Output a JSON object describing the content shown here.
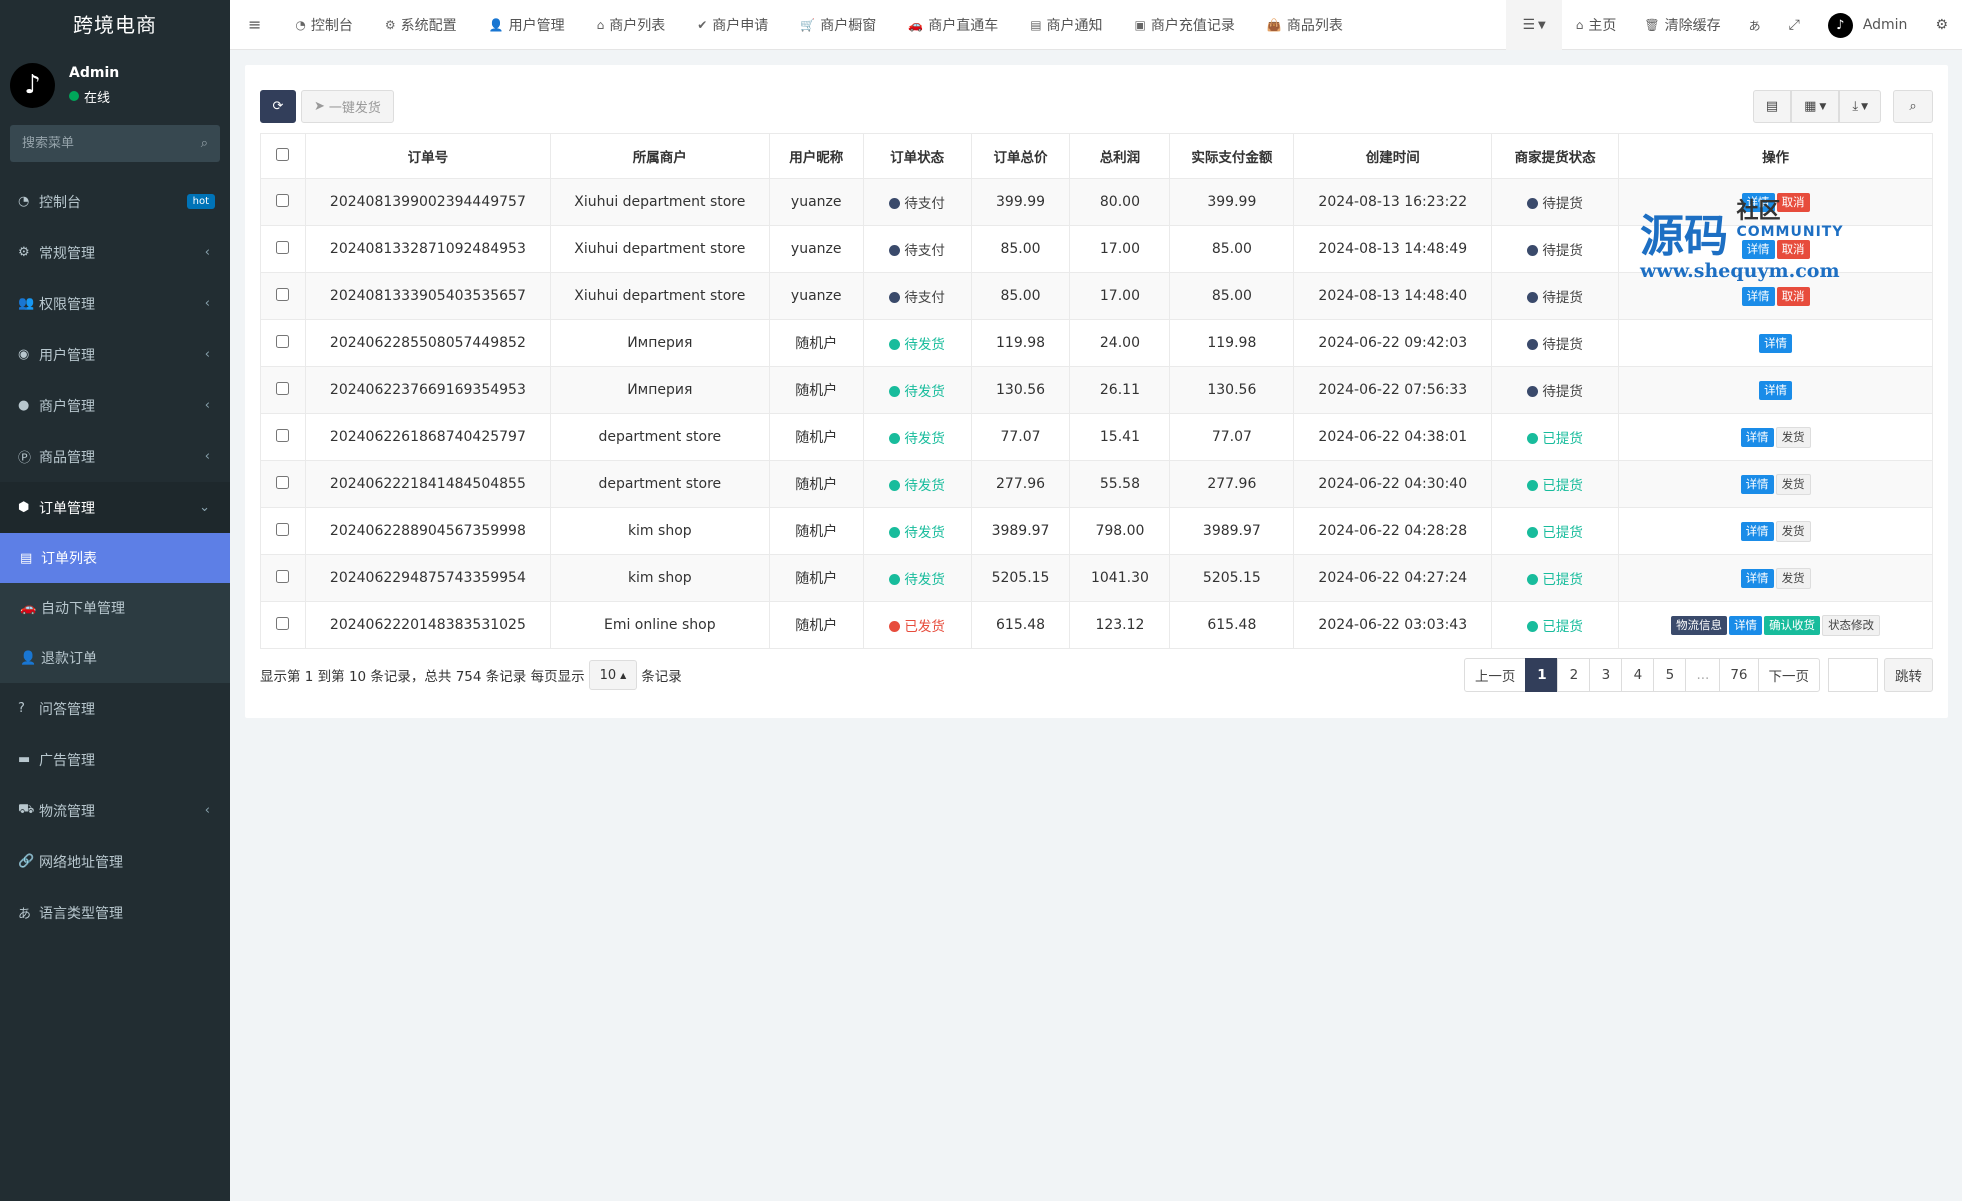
{
  "app": {
    "brand": "跨境电商"
  },
  "user": {
    "name": "Admin",
    "status": "在线"
  },
  "search": {
    "placeholder": "搜索菜单"
  },
  "sidebar": {
    "items": [
      {
        "label": "控制台",
        "icon": "dashboard-icon",
        "badge": "hot"
      },
      {
        "label": "常规管理",
        "icon": "cogs-icon"
      },
      {
        "label": "权限管理",
        "icon": "group-icon"
      },
      {
        "label": "用户管理",
        "icon": "user-circle-icon"
      },
      {
        "label": "商户管理",
        "icon": "apple-icon"
      },
      {
        "label": "商品管理",
        "icon": "product-icon"
      },
      {
        "label": "订单管理",
        "icon": "cube-icon"
      }
    ],
    "sub_items": [
      {
        "label": "订单列表",
        "icon": "list-icon"
      },
      {
        "label": "自动下单管理",
        "icon": "car-icon"
      },
      {
        "label": "退款订单",
        "icon": "user-icon"
      }
    ],
    "items_after": [
      {
        "label": "问答管理",
        "icon": "question-icon"
      },
      {
        "label": "广告管理",
        "icon": "ad-icon"
      },
      {
        "label": "物流管理",
        "icon": "truck-icon"
      },
      {
        "label": "网络地址管理",
        "icon": "link-icon"
      },
      {
        "label": "语言类型管理",
        "icon": "language-icon"
      }
    ]
  },
  "topnav": {
    "items": [
      {
        "label": "控制台",
        "icon": "dashboard-icon"
      },
      {
        "label": "系统配置",
        "icon": "gear-icon"
      },
      {
        "label": "用户管理",
        "icon": "user-icon"
      },
      {
        "label": "商户列表",
        "icon": "home-icon"
      },
      {
        "label": "商户申请",
        "icon": "check-circle-icon"
      },
      {
        "label": "商户橱窗",
        "icon": "cart-icon"
      },
      {
        "label": "商户直通车",
        "icon": "car-icon"
      },
      {
        "label": "商户通知",
        "icon": "list-icon"
      },
      {
        "label": "商户充值记录",
        "icon": "money-icon"
      },
      {
        "label": "商品列表",
        "icon": "shopping-bag-icon"
      }
    ],
    "home": "主页",
    "clear_cache": "清除缓存",
    "admin": "Admin"
  },
  "toolbar": {
    "ship_all": "一键发货"
  },
  "table": {
    "columns": [
      "订单号",
      "所属商户",
      "用户昵称",
      "订单状态",
      "订单总价",
      "总利润",
      "实际支付金额",
      "创建时间",
      "商家提货状态",
      "操作"
    ],
    "rows": [
      {
        "order_no": "2024081399002394449757",
        "merchant": "Xiuhui department store",
        "nick": "yuanze",
        "status": "待支付",
        "total": "399.99",
        "profit": "80.00",
        "paid": "399.99",
        "created": "2024-08-13 16:23:22",
        "pickup": "待提货"
      },
      {
        "order_no": "2024081332871092484953",
        "merchant": "Xiuhui department store",
        "nick": "yuanze",
        "status": "待支付",
        "total": "85.00",
        "profit": "17.00",
        "paid": "85.00",
        "created": "2024-08-13 14:48:49",
        "pickup": "待提货"
      },
      {
        "order_no": "2024081333905403535657",
        "merchant": "Xiuhui department store",
        "nick": "yuanze",
        "status": "待支付",
        "total": "85.00",
        "profit": "17.00",
        "paid": "85.00",
        "created": "2024-08-13 14:48:40",
        "pickup": "待提货"
      },
      {
        "order_no": "2024062285508057449852",
        "merchant": "Империя",
        "nick": "随机户",
        "status": "待发货",
        "total": "119.98",
        "profit": "24.00",
        "paid": "119.98",
        "created": "2024-06-22 09:42:03",
        "pickup": "待提货"
      },
      {
        "order_no": "2024062237669169354953",
        "merchant": "Империя",
        "nick": "随机户",
        "status": "待发货",
        "total": "130.56",
        "profit": "26.11",
        "paid": "130.56",
        "created": "2024-06-22 07:56:33",
        "pickup": "待提货"
      },
      {
        "order_no": "2024062261868740425797",
        "merchant": "department store",
        "nick": "随机户",
        "status": "待发货",
        "total": "77.07",
        "profit": "15.41",
        "paid": "77.07",
        "created": "2024-06-22 04:38:01",
        "pickup": "已提货"
      },
      {
        "order_no": "2024062221841484504855",
        "merchant": "department store",
        "nick": "随机户",
        "status": "待发货",
        "total": "277.96",
        "profit": "55.58",
        "paid": "277.96",
        "created": "2024-06-22 04:30:40",
        "pickup": "已提货"
      },
      {
        "order_no": "2024062288904567359998",
        "merchant": "kim shop",
        "nick": "随机户",
        "status": "待发货",
        "total": "3989.97",
        "profit": "798.00",
        "paid": "3989.97",
        "created": "2024-06-22 04:28:28",
        "pickup": "已提货"
      },
      {
        "order_no": "2024062294875743359954",
        "merchant": "kim shop",
        "nick": "随机户",
        "status": "待发货",
        "total": "5205.15",
        "profit": "1041.30",
        "paid": "5205.15",
        "created": "2024-06-22 04:27:24",
        "pickup": "已提货"
      },
      {
        "order_no": "2024062220148383531025",
        "merchant": "Emi online shop",
        "nick": "随机户",
        "status": "已发货",
        "total": "615.48",
        "profit": "123.12",
        "paid": "615.48",
        "created": "2024-06-22 03:03:43",
        "pickup": "已提货"
      }
    ],
    "actions": {
      "detail": "详情",
      "cancel": "取消",
      "ship": "发货",
      "logistics": "物流信息",
      "confirm": "确认收货",
      "modify": "状态修改"
    }
  },
  "footer": {
    "info_before": "显示第 1 到第 10 条记录，总共 754 条记录 每页显示",
    "page_size": "10",
    "info_after": "条记录",
    "prev": "上一页",
    "pages": [
      "1",
      "2",
      "3",
      "4",
      "5",
      "...",
      "76"
    ],
    "next": "下一页",
    "jump": "跳转"
  },
  "watermark": {
    "main": "源码",
    "sub_a": "社区",
    "sub_b": "COMMUNITY",
    "url": "www.shequym.com"
  },
  "colors": {
    "sidebar": "#222d32",
    "accent": "#323e5a",
    "selected": "#5d7fe6",
    "green": "#18bc9c",
    "red": "#e74c3c"
  }
}
